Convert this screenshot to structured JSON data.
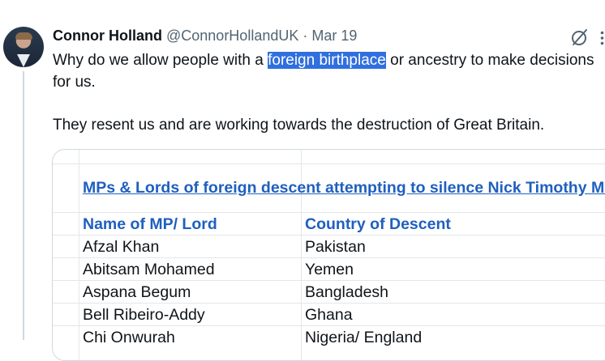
{
  "tweet": {
    "author_name": "Connor Holland",
    "handle": "@ConnorHollandUK",
    "separator": "·",
    "date": "Mar 19",
    "text_before_highlight": "Why do we allow people with a ",
    "highlighted_text": "foreign birthplace",
    "text_after_highlight": " or ancestry to make decisions for us.",
    "second_paragraph": "They resent us and are working towards the destruction of Great Britain."
  },
  "icons": {
    "grok": "slash-circle-icon",
    "more": "more-vertical-icon"
  },
  "image": {
    "title": "MPs & Lords of foreign descent attempting to silence Nick Timothy MP",
    "columns": [
      "Name of MP/ Lord",
      "Country of Descent"
    ],
    "rows": [
      [
        "Afzal Khan",
        "Pakistan"
      ],
      [
        "Abitsam Mohamed",
        "Yemen"
      ],
      [
        "Aspana Begum",
        "Bangladesh"
      ],
      [
        "Bell Ribeiro-Addy",
        "Ghana"
      ],
      [
        "Chi Onwurah",
        "Nigeria/ England"
      ]
    ]
  },
  "colors": {
    "highlight": "#2f6fde",
    "sheet_blue": "#1f5fbf"
  }
}
